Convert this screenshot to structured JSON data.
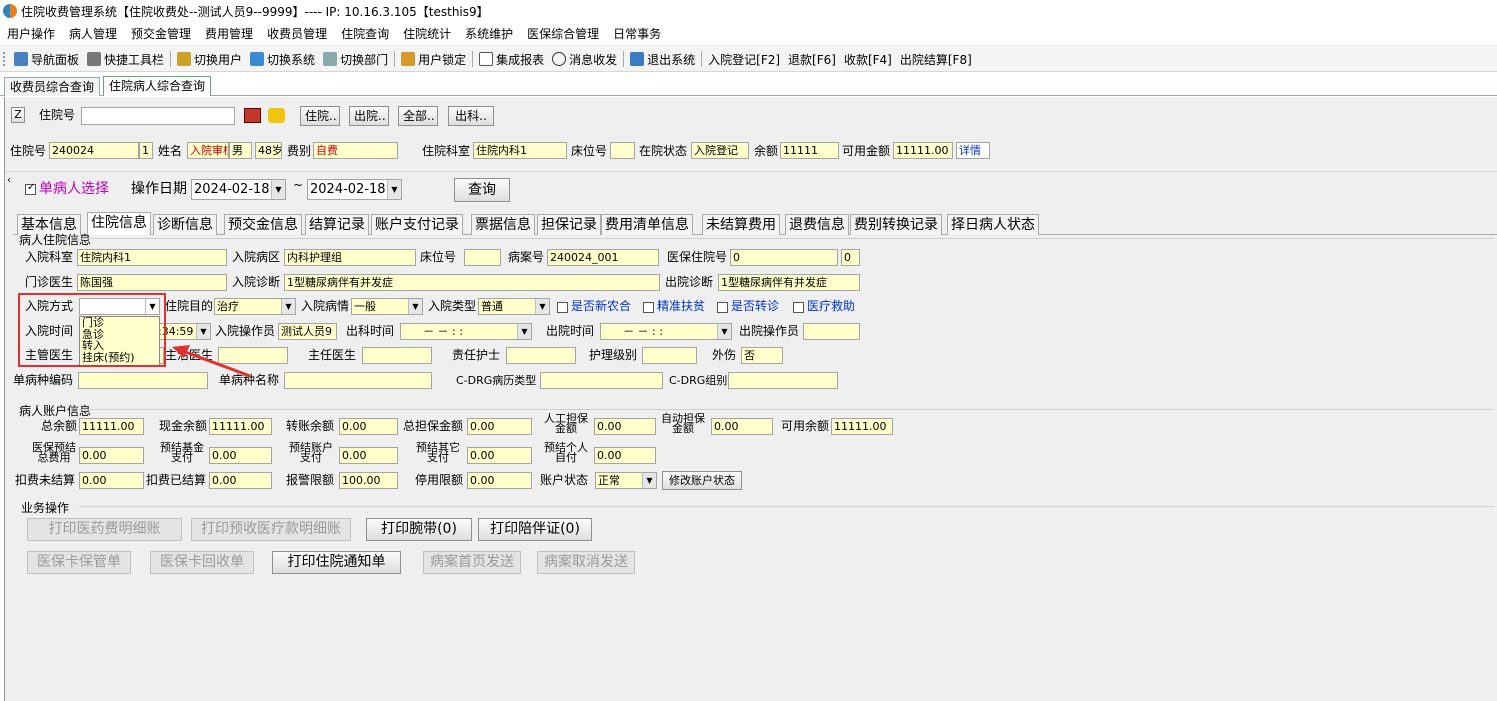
{
  "window": {
    "title": "住院收费管理系统【住院收费处--测试人员9--9999】---- IP: 10.16.3.105【testhis9】"
  },
  "menu": [
    "用户操作",
    "病人管理",
    "预交金管理",
    "费用管理",
    "收费员管理",
    "住院查询",
    "住院统计",
    "系统维护",
    "医保综合管理",
    "日常事务"
  ],
  "toolbar": {
    "nav": "导航面板",
    "quick": "快捷工具栏",
    "switch_user": "切换用户",
    "switch_sys": "切换系统",
    "switch_dept": "切换部门",
    "lock": "用户锁定",
    "report": "集成报表",
    "msg": "消息收发",
    "exit": "退出系统",
    "admit": "入院登记[F2]",
    "refund": "退款[F6]",
    "charge": "收款[F4]",
    "discharge": "出院结算[F8]"
  },
  "page_tabs": [
    "收费员综合查询",
    "住院病人综合查询"
  ],
  "search": {
    "z": "Z",
    "label": "住院号",
    "value": "",
    "btn1": "住院..",
    "btn2": "出院..",
    "btn3": "全部..",
    "btn4": "出科.."
  },
  "patient": {
    "no_label": "住院号",
    "no": "240024",
    "seq": "1",
    "name_label": "姓名",
    "name": "入院审核",
    "sex": "男",
    "age": "48岁",
    "fee_label": "费别",
    "fee": "自费",
    "dept_label": "住院科室",
    "dept": "住院内科1",
    "bed_label": "床位号",
    "bed": "",
    "status_label": "在院状态",
    "status": "入院登记",
    "bal_label": "余额",
    "bal": "11111",
    "avail_label": "可用金额",
    "avail": "11111.00",
    "detail": "详情"
  },
  "filter": {
    "single": "单病人选择",
    "date_label": "操作日期",
    "date_from": "2024-02-18",
    "tilde": "~",
    "date_to": "2024-02-18",
    "query": "查询"
  },
  "tabs": [
    "基本信息",
    "住院信息",
    "诊断信息",
    "预交金信息",
    "结算记录",
    "账户支付记录",
    "票据信息",
    "担保记录",
    "费用清单信息",
    "未结算费用",
    "退费信息",
    "费别转换记录",
    "择日病人状态"
  ],
  "inpatient": {
    "group": "病人住院信息",
    "dept_l": "入院科室",
    "dept": "住院内科1",
    "ward_l": "入院病区",
    "ward": "内科护理组",
    "bed_l": "床位号",
    "bed": "",
    "case_l": "病案号",
    "case": "240024_001",
    "ins_l": "医保住院号",
    "ins": "0",
    "ins2": "0",
    "doc_l": "门诊医生",
    "doc": "陈国强",
    "diag_l": "入院诊断",
    "diag": "1型糖尿病伴有并发症",
    "odiag_l": "出院诊断",
    "odiag": "1型糖尿病伴有并发症",
    "mode_l": "入院方式",
    "mode": "",
    "purpose_l": "住院目的",
    "purpose": "治疗",
    "cond_l": "入院病情",
    "cond": "一般",
    "type_l": "入院类型",
    "type": "普通",
    "c1": "是否新农合",
    "c2": "精准扶贫",
    "c3": "是否转诊",
    "c4": "医疗救助",
    "time_l": "入院时间",
    "time": ":34:59",
    "op_l": "入院操作员",
    "op": "测试人员9",
    "out_l": "出科时间",
    "out": "－ －  : :",
    "dis_l": "出院时间",
    "dis": "－ －  : :",
    "disop_l": "出院操作员",
    "disop": "",
    "main_doc_l": "主管医生",
    "att_l": "主治医生",
    "chief_l": "主任医生",
    "nurse_l": "责任护士",
    "care_l": "护理级别",
    "trauma_l": "外伤",
    "trauma": "否",
    "sd_code_l": "单病种编码",
    "sd_name_l": "单病种名称",
    "drg_type_l": "C-DRG病历类型",
    "drg_grp_l": "C-DRG组别"
  },
  "mode_options": [
    "门诊",
    "急诊",
    "转入",
    "挂床(预约)"
  ],
  "account": {
    "group": "病人账户信息",
    "total_l": "总余额",
    "total": "11111.00",
    "cash_l": "现金余额",
    "cash": "11111.00",
    "trans_l": "转账余额",
    "trans": "0.00",
    "guar_l": "总担保金额",
    "guar": "0.00",
    "manual_l": "人工担保金额",
    "manual": "0.00",
    "auto_l": "自动担保金额",
    "auto": "0.00",
    "avail_l": "可用余额",
    "avail": "11111.00",
    "p1_l": "医保预结总费用",
    "p1": "0.00",
    "p2_l": "预结基金支付",
    "p2": "0.00",
    "p3_l": "预结账户支付",
    "p3": "0.00",
    "p4_l": "预结其它支付",
    "p4": "0.00",
    "p5_l": "预结个人自付",
    "p5": "0.00",
    "unset_l": "扣费未结算",
    "unset": "0.00",
    "set_l": "扣费已结算",
    "set": "0.00",
    "alarm_l": "报警限额",
    "alarm": "100.00",
    "stop_l": "停用限额",
    "stop": "0.00",
    "state_l": "账户状态",
    "state": "正常",
    "modify": "修改账户状态"
  },
  "ops": {
    "group": "业务操作",
    "b1": "打印医药费明细账",
    "b2": "打印预收医疗款明细账",
    "b3": "打印腕带(0)",
    "b4": "打印陪伴证(0)",
    "b5": "医保卡保管单",
    "b6": "医保卡回收单",
    "b7": "打印住院通知单",
    "b8": "病案首页发送",
    "b9": "病案取消发送"
  }
}
